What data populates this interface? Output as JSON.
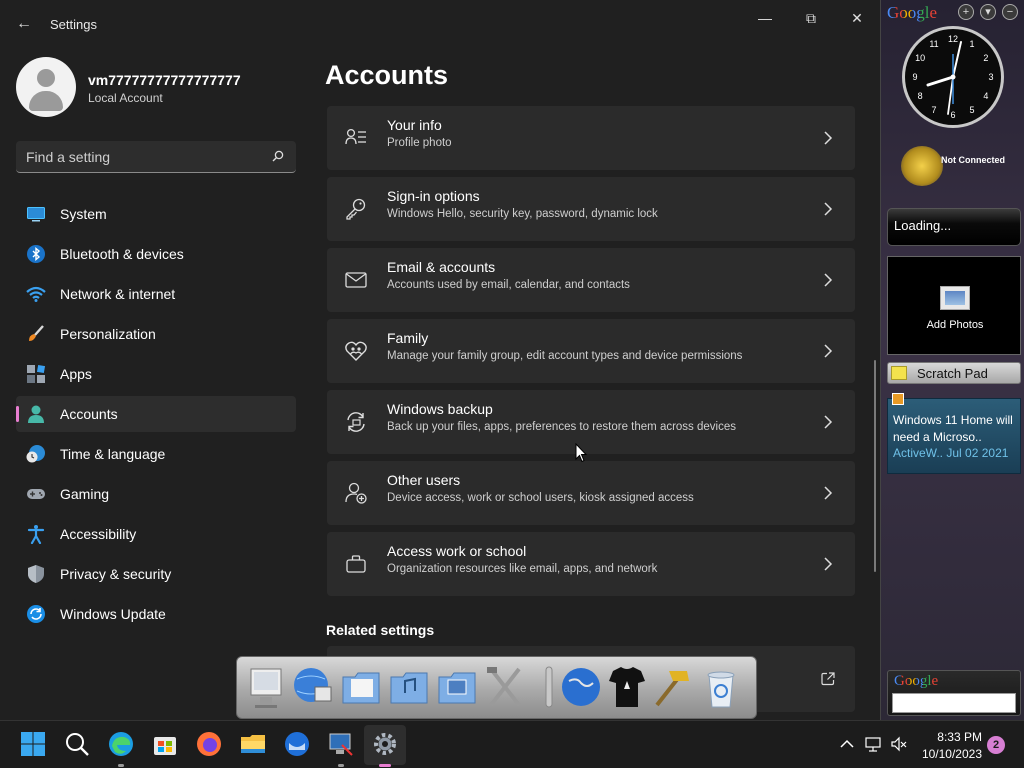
{
  "window": {
    "title": "Settings",
    "back": "←",
    "minimize": "—",
    "maximize": "⧉",
    "close": "✕"
  },
  "profile": {
    "name": "vm77777777777777777",
    "account_type": "Local Account"
  },
  "search": {
    "placeholder": "Find a setting"
  },
  "nav": {
    "items": [
      {
        "label": "System",
        "icon": "system-icon"
      },
      {
        "label": "Bluetooth & devices",
        "icon": "bluetooth-icon"
      },
      {
        "label": "Network & internet",
        "icon": "wifi-icon"
      },
      {
        "label": "Personalization",
        "icon": "brush-icon"
      },
      {
        "label": "Apps",
        "icon": "apps-icon"
      },
      {
        "label": "Accounts",
        "icon": "accounts-icon",
        "active": true
      },
      {
        "label": "Time & language",
        "icon": "clock-globe-icon"
      },
      {
        "label": "Gaming",
        "icon": "gamepad-icon"
      },
      {
        "label": "Accessibility",
        "icon": "accessibility-icon"
      },
      {
        "label": "Privacy & security",
        "icon": "shield-icon"
      },
      {
        "label": "Windows Update",
        "icon": "update-icon"
      }
    ]
  },
  "main": {
    "title": "Accounts",
    "cards": [
      {
        "title": "Your info",
        "subtitle": "Profile photo",
        "icon": "person-list-icon"
      },
      {
        "title": "Sign-in options",
        "subtitle": "Windows Hello, security key, password, dynamic lock",
        "icon": "key-icon"
      },
      {
        "title": "Email & accounts",
        "subtitle": "Accounts used by email, calendar, and contacts",
        "icon": "mail-icon"
      },
      {
        "title": "Family",
        "subtitle": "Manage your family group, edit account types and device permissions",
        "icon": "heart-people-icon"
      },
      {
        "title": "Windows backup",
        "subtitle": "Back up your files, apps, preferences to restore them across devices",
        "icon": "backup-icon"
      },
      {
        "title": "Other users",
        "subtitle": "Device access, work or school users, kiosk assigned access",
        "icon": "person-add-icon"
      },
      {
        "title": "Access work or school",
        "subtitle": "Organization resources like email, apps, and network",
        "icon": "briefcase-icon"
      }
    ],
    "related_heading": "Related settings"
  },
  "gadgets": {
    "google_logo": "Google",
    "add": "+",
    "options": "▾",
    "collapse": "−",
    "clock_numbers": [
      "12",
      "1",
      "2",
      "3",
      "4",
      "5",
      "6",
      "7",
      "8",
      "9",
      "10",
      "11"
    ],
    "weather_status": "Not Connected",
    "loading_text": "Loading...",
    "photos_text": "Add Photos",
    "scratch_pad": "Scratch Pad",
    "feed_title": "Windows 11 Home will need a Microso..",
    "feed_source": "ActiveW..",
    "feed_date": "Jul 02 2021",
    "search_logo": "Google"
  },
  "taskbar": {
    "time": "8:33 PM",
    "date": "10/10/2023",
    "notifications": "2"
  },
  "colors": {
    "accent": "#e87ed1",
    "window_bg": "#202020",
    "card_bg": "#2b2b2b"
  }
}
